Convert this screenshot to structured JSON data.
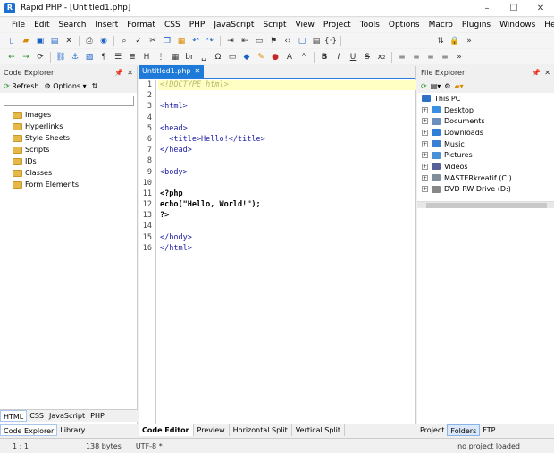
{
  "window": {
    "title": "Rapid PHP - [Untitled1.php]",
    "minimize": "–",
    "maximize": "☐",
    "close": "✕"
  },
  "menu": [
    "File",
    "Edit",
    "Search",
    "Insert",
    "Format",
    "CSS",
    "PHP",
    "JavaScript",
    "Script",
    "View",
    "Project",
    "Tools",
    "Options",
    "Macro",
    "Plugins",
    "Windows",
    "Help"
  ],
  "left_panel": {
    "title": "Code Explorer",
    "refresh": "Refresh",
    "options": "Options",
    "items": [
      "Images",
      "Hyperlinks",
      "Style Sheets",
      "Scripts",
      "IDs",
      "Classes",
      "Form Elements"
    ],
    "lang_tabs": [
      "HTML",
      "CSS",
      "JavaScript",
      "PHP"
    ],
    "bottom_tabs": [
      "Code Explorer",
      "Library"
    ]
  },
  "editor": {
    "tab_label": "Untitled1.php",
    "lines": [
      {
        "n": "1",
        "text": "<!DOCTYPE html>",
        "cls": "c-doctype",
        "hl": true
      },
      {
        "n": "2",
        "text": "",
        "cls": "c-tag"
      },
      {
        "n": "3",
        "text": "<html>",
        "cls": "c-tag"
      },
      {
        "n": "4",
        "text": "",
        "cls": "c-tag"
      },
      {
        "n": "5",
        "text": "<head>",
        "cls": "c-tag"
      },
      {
        "n": "6",
        "text": "  <title>Hello!</title>",
        "cls": "c-tag"
      },
      {
        "n": "7",
        "text": "</head>",
        "cls": "c-tag"
      },
      {
        "n": "8",
        "text": "",
        "cls": "c-tag"
      },
      {
        "n": "9",
        "text": "<body>",
        "cls": "c-tag"
      },
      {
        "n": "10",
        "text": "",
        "cls": "c-tag"
      },
      {
        "n": "11",
        "text": "<?php",
        "cls": "c-php"
      },
      {
        "n": "12",
        "text": "echo(\"Hello, World!\");",
        "cls": "c-php"
      },
      {
        "n": "13",
        "text": "?>",
        "cls": "c-php"
      },
      {
        "n": "14",
        "text": "",
        "cls": "c-tag"
      },
      {
        "n": "15",
        "text": "</body>",
        "cls": "c-tag"
      },
      {
        "n": "16",
        "text": "</html>",
        "cls": "c-tag"
      }
    ],
    "bottom_tabs": [
      "Code Editor",
      "Preview",
      "Horizontal Split",
      "Vertical Split"
    ]
  },
  "right_panel": {
    "title": "File Explorer",
    "root": "This PC",
    "items": [
      {
        "label": "Desktop",
        "color": "#3b8fde"
      },
      {
        "label": "Documents",
        "color": "#6a8fbf"
      },
      {
        "label": "Downloads",
        "color": "#2f7fd8"
      },
      {
        "label": "Music",
        "color": "#3a7fd1"
      },
      {
        "label": "Pictures",
        "color": "#4a90d9"
      },
      {
        "label": "Videos",
        "color": "#555f9a"
      },
      {
        "label": "MASTERkreatif (C:)",
        "color": "#7f8c99"
      },
      {
        "label": "DVD RW Drive (D:)",
        "color": "#888888"
      }
    ],
    "bottom_tabs": [
      "Project",
      "Folders",
      "FTP"
    ]
  },
  "status": {
    "position": "1 : 1",
    "size": "138 bytes",
    "encoding": "UTF-8 *",
    "project": "no project loaded"
  }
}
